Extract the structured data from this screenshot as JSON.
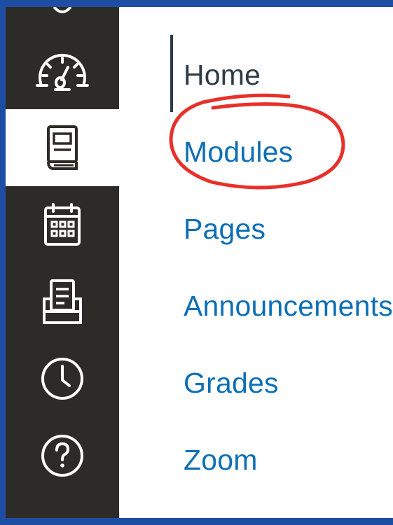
{
  "global_nav": {
    "background_color": "#2d2b27",
    "items": [
      {
        "icon": "dashboard-icon",
        "active": false
      },
      {
        "icon": "courses-icon",
        "active": true
      },
      {
        "icon": "calendar-icon",
        "active": false
      },
      {
        "icon": "inbox-icon",
        "active": false
      },
      {
        "icon": "history-icon",
        "active": false
      },
      {
        "icon": "help-icon",
        "active": false
      }
    ]
  },
  "course_nav": {
    "link_color": "#0d6fb5",
    "current_color": "#2d3b45",
    "items": [
      {
        "label": "Home",
        "current": true
      },
      {
        "label": "Modules",
        "current": false,
        "annotated": true
      },
      {
        "label": "Pages",
        "current": false
      },
      {
        "label": "Announcements",
        "current": false
      },
      {
        "label": "Grades",
        "current": false
      },
      {
        "label": "Zoom",
        "current": false
      }
    ]
  },
  "annotation": {
    "shape": "hand-drawn-circle",
    "color": "#e8302b",
    "target": "Modules"
  },
  "frame_border_color": "#1d4ea3"
}
